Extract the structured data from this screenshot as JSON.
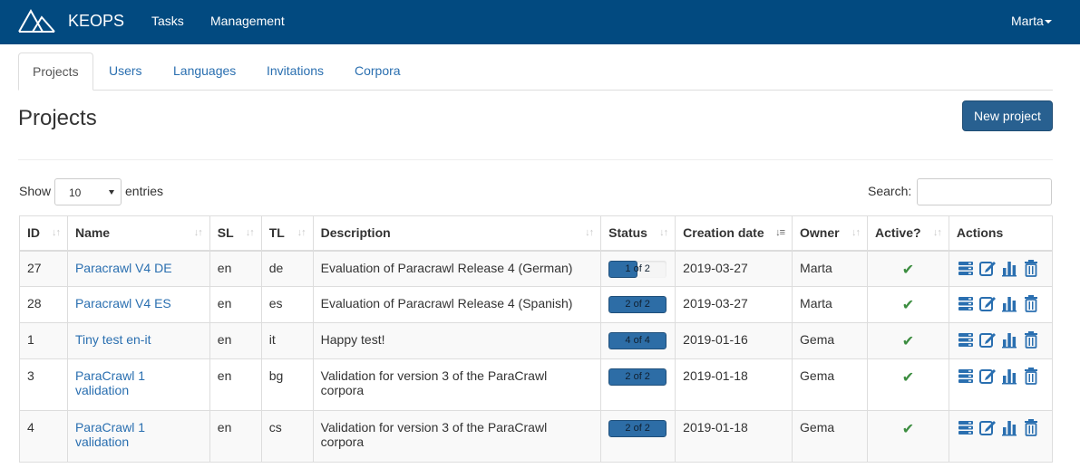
{
  "navbar": {
    "brand": "KEOPS",
    "links": [
      "Tasks",
      "Management"
    ],
    "user": "Marta"
  },
  "tabs": [
    "Projects",
    "Users",
    "Languages",
    "Invitations",
    "Corpora"
  ],
  "page": {
    "title": "Projects",
    "new_button": "New project"
  },
  "table_controls": {
    "show_label": "Show",
    "entries_value": "10",
    "entries_label": "entries",
    "search_label": "Search:",
    "search_value": ""
  },
  "table": {
    "headers": [
      "ID",
      "Name",
      "SL",
      "TL",
      "Description",
      "Status",
      "Creation date",
      "Owner",
      "Active?",
      "Actions"
    ],
    "rows": [
      {
        "id": "27",
        "name": "Paracrawl V4 DE",
        "sl": "en",
        "tl": "de",
        "description": "Evaluation of Paracrawl Release 4 (German)",
        "status": "1 of 2",
        "progress": 0.5,
        "date": "2019-03-27",
        "owner": "Marta",
        "active": "✔"
      },
      {
        "id": "28",
        "name": "Paracrawl V4 ES",
        "sl": "en",
        "tl": "es",
        "description": "Evaluation of Paracrawl Release 4 (Spanish)",
        "status": "2 of 2",
        "progress": 1.0,
        "date": "2019-03-27",
        "owner": "Marta",
        "active": "✔"
      },
      {
        "id": "1",
        "name": "Tiny test en-it",
        "sl": "en",
        "tl": "it",
        "description": "Happy test!",
        "status": "4 of 4",
        "progress": 1.0,
        "date": "2019-01-16",
        "owner": "Gema",
        "active": "✔"
      },
      {
        "id": "3",
        "name": "ParaCrawl 1 validation",
        "sl": "en",
        "tl": "bg",
        "description": "Validation for version 3 of the ParaCrawl corpora",
        "status": "2 of 2",
        "progress": 1.0,
        "date": "2019-01-18",
        "owner": "Gema",
        "active": "✔"
      },
      {
        "id": "4",
        "name": "ParaCrawl 1 validation",
        "sl": "en",
        "tl": "cs",
        "description": "Validation for version 3 of the ParaCrawl corpora",
        "status": "2 of 2",
        "progress": 1.0,
        "date": "2019-01-18",
        "owner": "Gema",
        "active": "✔"
      }
    ],
    "action_icons": [
      "tasks-icon",
      "edit-icon",
      "stats-icon",
      "trash-icon"
    ]
  },
  "colors": {
    "navbar": "#024a80",
    "link": "#2a6fb0",
    "primary": "#286090",
    "check": "#3c8d40"
  }
}
